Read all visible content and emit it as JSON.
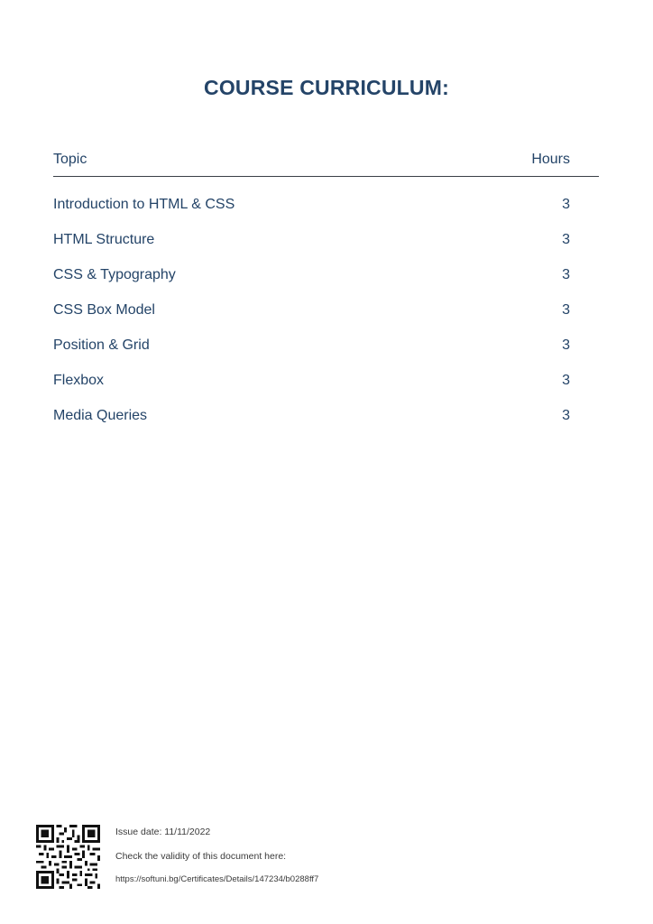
{
  "title": "COURSE CURRICULUM:",
  "table": {
    "headers": {
      "topic": "Topic",
      "hours": "Hours"
    },
    "rows": [
      {
        "topic": "Introduction to HTML & CSS",
        "hours": "3"
      },
      {
        "topic": "HTML Structure",
        "hours": "3"
      },
      {
        "topic": "CSS & Typography",
        "hours": "3"
      },
      {
        "topic": "CSS Box Model",
        "hours": "3"
      },
      {
        "topic": "Position & Grid",
        "hours": "3"
      },
      {
        "topic": "Flexbox",
        "hours": "3"
      },
      {
        "topic": "Media Queries",
        "hours": "3"
      }
    ]
  },
  "footer": {
    "qr_icon": "qr-code-icon",
    "issue_date": "Issue date: 11/11/2022",
    "check_text": "Check the validity of this document here:",
    "url": "https://softuni.bg/Certificates/Details/147234/b0288ff7"
  },
  "colors": {
    "heading": "#244468",
    "text": "#244468",
    "rule": "#3a3f46"
  }
}
